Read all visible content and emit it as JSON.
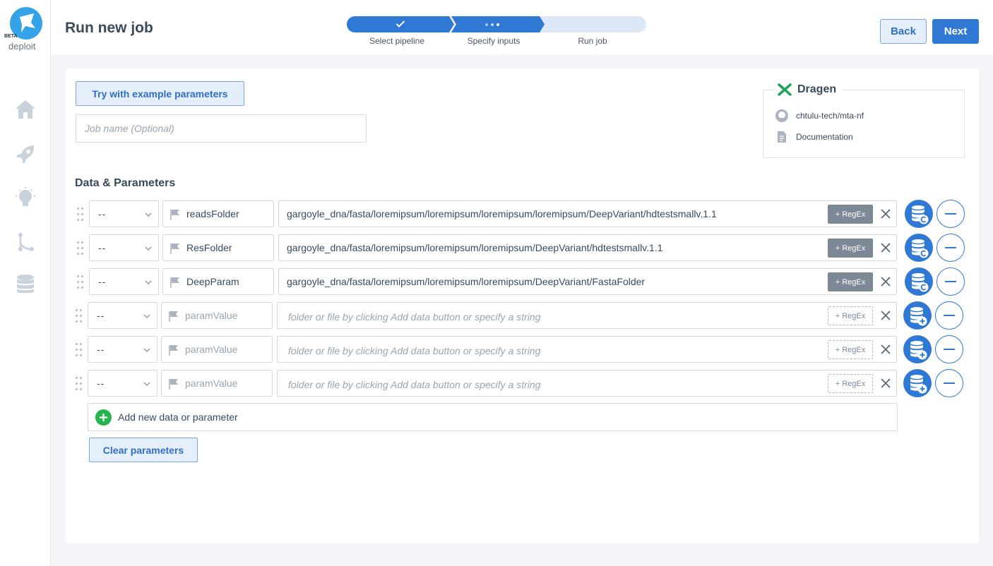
{
  "sidebar": {
    "beta_label": "BETA",
    "app_name": "deploit",
    "nav": [
      "home-icon",
      "rocket-icon",
      "lightbulb-icon",
      "pipeline-icon",
      "database-icon"
    ]
  },
  "header": {
    "title": "Run new job",
    "steps": [
      {
        "label": "Select pipeline",
        "state": "complete"
      },
      {
        "label": "Specify inputs",
        "state": "current"
      },
      {
        "label": "Run job",
        "state": "upcoming"
      }
    ],
    "back_label": "Back",
    "next_label": "Next"
  },
  "form": {
    "example_button": "Try with example parameters",
    "job_name_placeholder": "Job name (Optional)",
    "section_title": "Data & Parameters",
    "add_row_label": "Add new data or parameter",
    "clear_label": "Clear parameters"
  },
  "pipeline": {
    "name": "Dragen",
    "repo": "chtulu-tech/mta-nf",
    "docs": "Documentation"
  },
  "params": [
    {
      "prefix": "--",
      "name": "readsFolder",
      "value": "gargoyle_dna/fasta/loremipsum/loremipsum/loremipsum/loremipsum/DeepVariant/hdtestsmallv.1.1",
      "regex": "+ RegEx",
      "filled": true
    },
    {
      "prefix": "--",
      "name": "ResFolder",
      "value": "gargoyle_dna/fasta/loremipsum/loremipsum/loremipsum/DeepVariant/hdtestsmallv.1.1",
      "regex": "+ RegEx",
      "filled": true
    },
    {
      "prefix": "--",
      "name": "DeepParam",
      "value": "gargoyle_dna/fasta/loremipsum/loremipsum/loremipsum/DeepVariant/FastaFolder",
      "regex": "+ RegEx",
      "filled": true
    },
    {
      "prefix": "--",
      "name": "paramValue",
      "value": "folder or file by clicking Add data button or specify a string",
      "regex": "+ RegEx",
      "filled": false
    },
    {
      "prefix": "--",
      "name": "paramValue",
      "value": "folder or file by clicking Add data button or specify a string",
      "regex": "+ RegEx",
      "filled": false
    },
    {
      "prefix": "--",
      "name": "paramValue",
      "value": "folder or file by clicking Add data button or specify a string",
      "regex": "+ RegEx",
      "filled": false
    }
  ],
  "colors": {
    "accent": "#2f78d4",
    "success": "#27b44f",
    "brand": "#35a3e8"
  }
}
